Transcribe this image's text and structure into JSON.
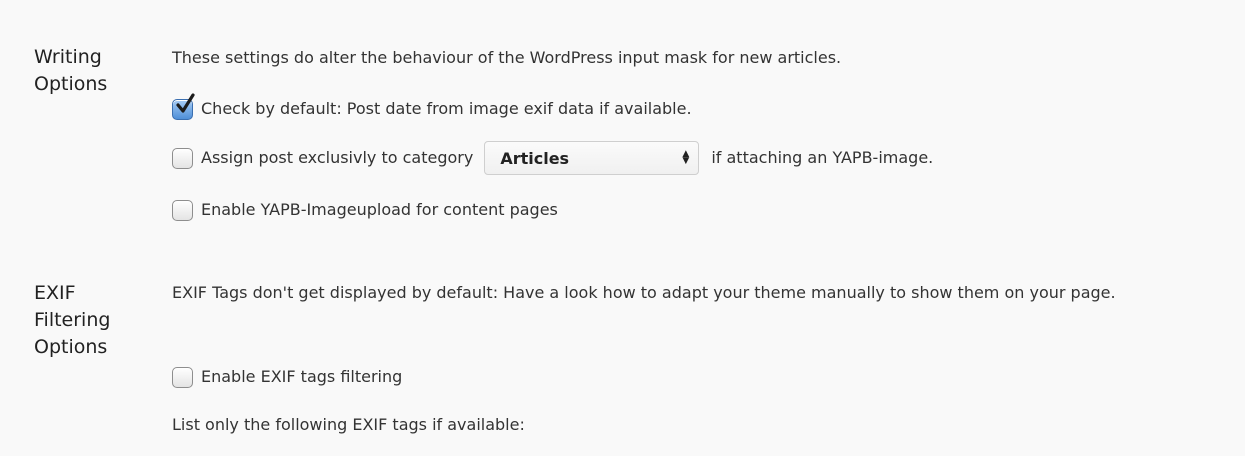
{
  "writing": {
    "label": "Writing\nOptions",
    "description": "These settings do alter the behaviour of the WordPress input mask for new articles.",
    "options": {
      "post_date": {
        "checked": true,
        "label": "Check by default: Post date from image exif data if available."
      },
      "assign_category": {
        "checked": false,
        "label_before": "Assign post exclusivly to category",
        "selected_category": "Articles",
        "label_after": "if attaching an YAPB-image."
      },
      "imageupload": {
        "checked": false,
        "label": "Enable YAPB-Imageupload for content pages"
      }
    }
  },
  "exif": {
    "label": "EXIF\nFiltering\nOptions",
    "description": "EXIF Tags don't get displayed by default: Have a look how to adapt your theme manually to show them on your page.",
    "options": {
      "filtering": {
        "checked": false,
        "label": "Enable EXIF tags filtering"
      }
    },
    "list_label": "List only the following EXIF tags if available:"
  },
  "icons": {
    "checkmark": "checkmark-icon",
    "select_arrows": "select-arrows-icon"
  },
  "colors": {
    "background": "#f9f9f9",
    "checkbox_checked": "#4f8fd8",
    "text": "#333333"
  }
}
